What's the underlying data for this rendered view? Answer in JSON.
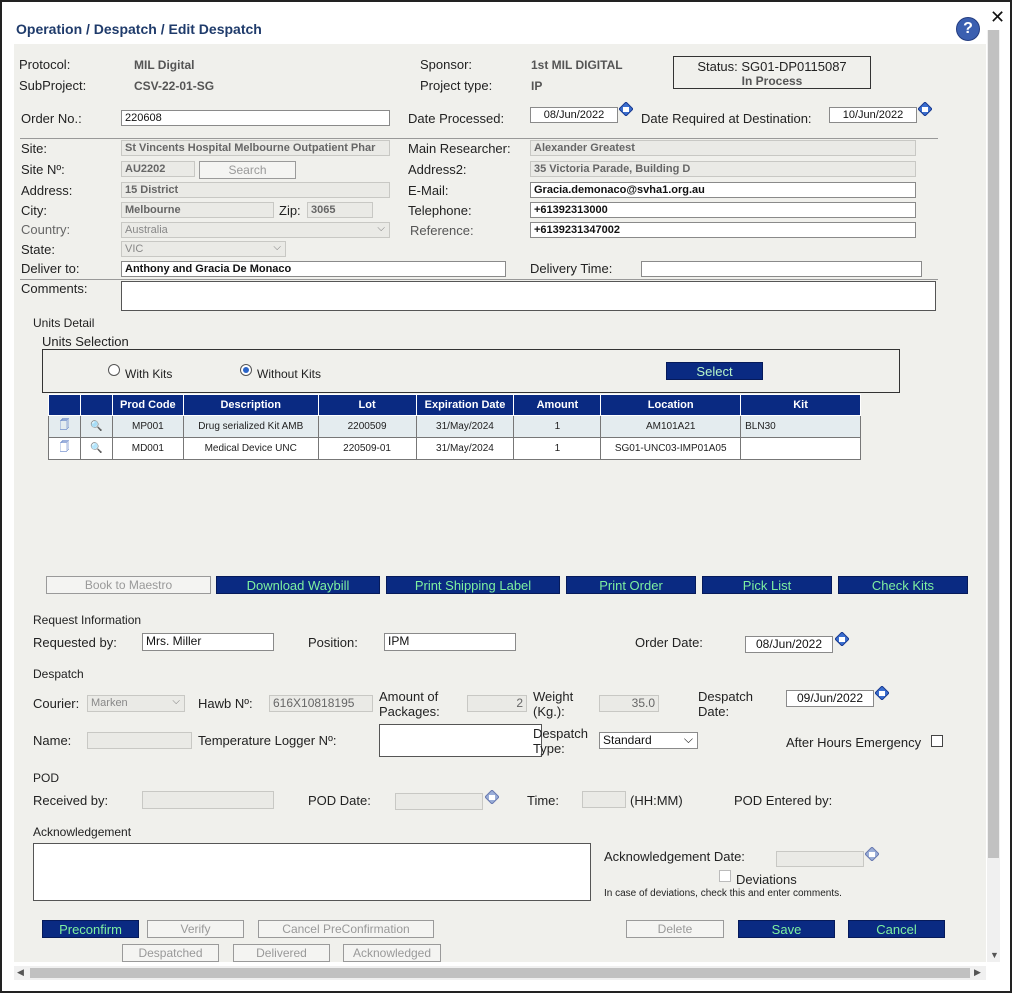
{
  "window": {
    "title": "Operation / Despatch / Edit Despatch",
    "help_glyph": "?",
    "close_glyph": "✕"
  },
  "header": {
    "protocol_label": "Protocol:",
    "protocol_value": "MIL Digital",
    "subproject_label": "SubProject:",
    "subproject_value": "CSV-22-01-SG",
    "sponsor_label": "Sponsor:",
    "sponsor_value": "1st MIL DIGITAL",
    "project_type_label": "Project type:",
    "project_type_value": "IP",
    "status_line1": "Status: SG01-DP0115087",
    "status_line2": "In Process"
  },
  "order": {
    "order_no_label": "Order No.:",
    "order_no_value": "220608",
    "date_processed_label": "Date Processed:",
    "date_processed_value": "08/Jun/2022",
    "date_required_label": "Date Required at Destination:",
    "date_required_value": "10/Jun/2022"
  },
  "site": {
    "site_label": "Site:",
    "site_value": "St Vincents Hospital Melbourne Outpatient Phar",
    "site_no_label": "Site Nº:",
    "site_no_value": "AU2202",
    "search_label": "Search",
    "address_label": "Address:",
    "address_value": "15 District",
    "city_label": "City:",
    "city_value": "Melbourne",
    "zip_label": "Zip:",
    "zip_value": "3065",
    "country_label": "Country:",
    "country_value": "Australia",
    "state_label": "State:",
    "state_value": "VIC",
    "main_researcher_label": "Main Researcher:",
    "main_researcher_value": "Alexander Greatest",
    "address2_label": "Address2:",
    "address2_value": "35 Victoria Parade, Building D",
    "email_label": "E-Mail:",
    "email_value": "Gracia.demonaco@svha1.org.au",
    "telephone_label": "Telephone:",
    "telephone_value": "+61392313000",
    "reference_label": "Reference:",
    "reference_value": "+6139231347002",
    "deliver_to_label": "Deliver to:",
    "deliver_to_value": "Anthony and Gracia De Monaco",
    "delivery_time_label": "Delivery Time:",
    "delivery_time_value": "",
    "comments_label": "Comments:"
  },
  "units": {
    "detail_label": "Units Detail",
    "selection_label": "Units Selection",
    "with_kits_label": "With Kits",
    "without_kits_label": "Without Kits",
    "select_button": "Select",
    "columns": [
      "Prod Code",
      "Description",
      "Lot",
      "Expiration Date",
      "Amount",
      "Location",
      "Kit"
    ],
    "rows": [
      [
        "MP001",
        "Drug serialized Kit AMB",
        "2200509",
        "31/May/2024",
        "1",
        "AM101A21",
        "BLN30"
      ],
      [
        "MD001",
        "Medical Device UNC",
        "220509-01",
        "31/May/2024",
        "1",
        "SG01-UNC03-IMP01A05",
        ""
      ]
    ]
  },
  "actions": {
    "book_to_maestro": "Book to Maestro",
    "download_waybill": "Download Waybill",
    "print_shipping_label": "Print Shipping Label",
    "print_order": "Print Order",
    "pick_list": "Pick List",
    "check_kits": "Check Kits"
  },
  "request": {
    "section_label": "Request Information",
    "requested_by_label": "Requested by:",
    "requested_by_value": "Mrs. Miller",
    "position_label": "Position:",
    "position_value": "IPM",
    "order_date_label": "Order Date:",
    "order_date_value": "08/Jun/2022"
  },
  "despatch": {
    "section_label": "Despatch",
    "courier_label": "Courier:",
    "courier_value": "Marken",
    "hawb_label": "Hawb Nº:",
    "hawb_value": "616X10818195",
    "packages_label_1": "Amount of",
    "packages_label_2": "Packages:",
    "packages_value": "2",
    "weight_label_1": "Weight",
    "weight_label_2": "(Kg.):",
    "weight_value": "35.0",
    "despatch_date_label_1": "Despatch",
    "despatch_date_label_2": "Date:",
    "despatch_date_value": "09/Jun/2022",
    "name_label": "Name:",
    "temp_logger_label": "Temperature Logger Nº:",
    "despatch_type_label_1": "Despatch",
    "despatch_type_label_2": "Type:",
    "despatch_type_value": "Standard",
    "after_hours_label": "After Hours Emergency"
  },
  "pod": {
    "section_label": "POD",
    "received_by_label": "Received by:",
    "pod_date_label": "POD Date:",
    "time_label": "Time:",
    "time_format": "(HH:MM)",
    "pod_entered_by_label": "POD Entered by:"
  },
  "acknowledgement": {
    "section_label": "Acknowledgement",
    "date_label": "Acknowledgement Date:",
    "deviations_label": "Deviations",
    "deviations_note": "In case of deviations, check this and enter comments."
  },
  "footer": {
    "preconfirm": "Preconfirm",
    "verify": "Verify",
    "cancel_preconfirmation": "Cancel PreConfirmation",
    "despatched": "Despatched",
    "delivered": "Delivered",
    "acknowledged": "Acknowledged",
    "delete": "Delete",
    "save": "Save",
    "cancel": "Cancel"
  },
  "colors": {
    "accent_blue": "#0a2a82",
    "button_text_green": "#7ef0a0",
    "panel_bg": "#f0f0ec"
  }
}
